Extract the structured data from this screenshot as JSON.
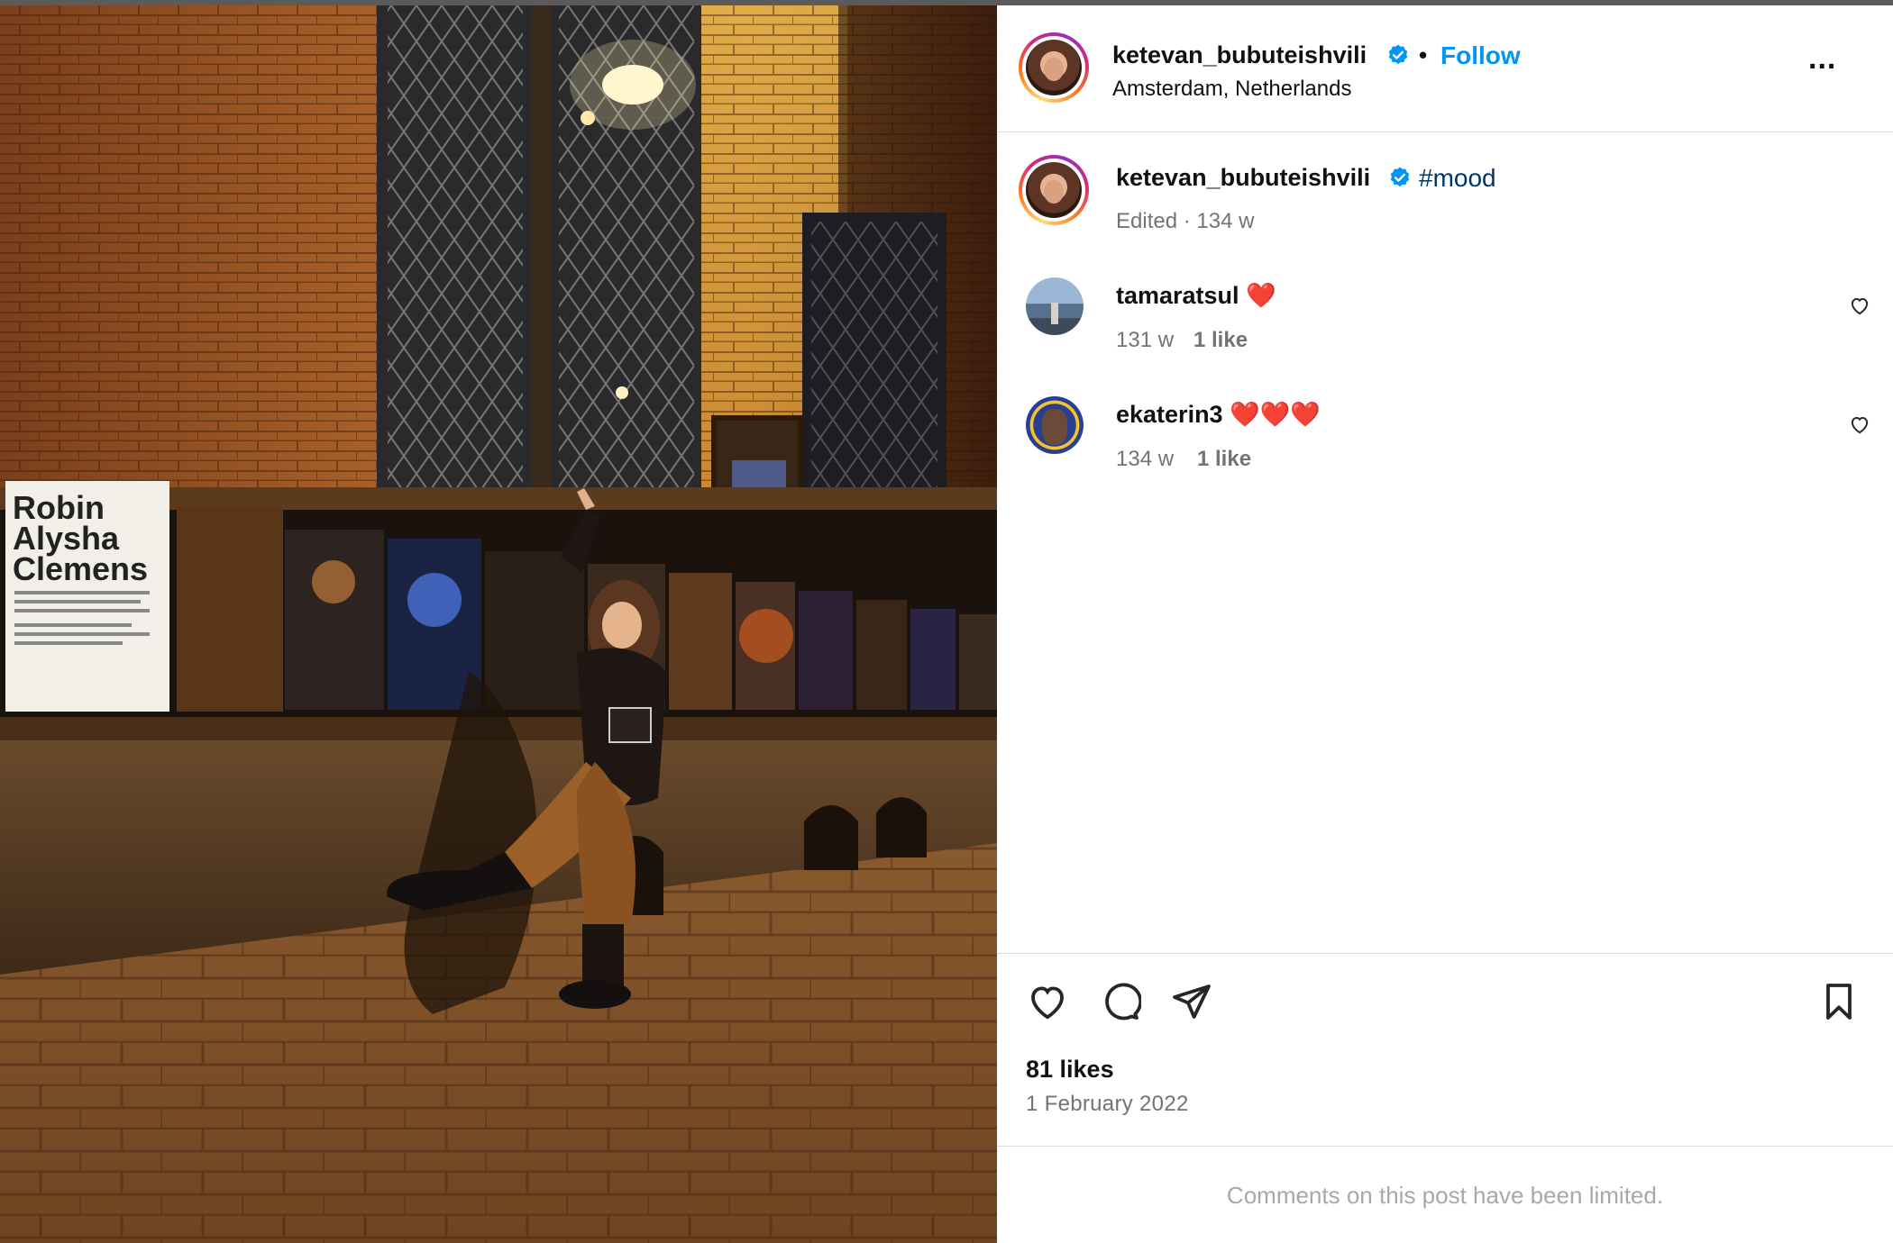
{
  "post": {
    "author": "ketevan_bubuteishvili",
    "follow_label": "Follow",
    "separator": "•",
    "location": "Amsterdam, Netherlands",
    "more_label": "...",
    "caption": {
      "username": "ketevan_bubuteishvili",
      "hashtag": "#mood",
      "meta": "Edited · 134 w"
    },
    "comments": [
      {
        "username": "tamaratsul",
        "text": "❤️",
        "age": "131 w",
        "likes": "1 like"
      },
      {
        "username": "ekaterin3",
        "text": "❤️❤️❤️",
        "age": "134 w",
        "likes": "1 like"
      }
    ],
    "likes_count": "81 likes",
    "date": "1 February 2022",
    "comments_limited": "Comments on this post have been limited."
  },
  "photo": {
    "poster_title": [
      "Robin",
      "Alysha",
      "Clemens"
    ]
  },
  "colors": {
    "follow_blue": "#0095f6",
    "hashtag_blue": "#00376b",
    "muted_gray": "#737373",
    "verified_blue": "#0095f6",
    "heart_red": "#ed4956"
  },
  "icons": {
    "verified": "verified-badge-icon",
    "like": "heart-icon",
    "comment": "comment-icon",
    "share": "share-icon",
    "save": "bookmark-icon",
    "more": "more-options-icon"
  }
}
